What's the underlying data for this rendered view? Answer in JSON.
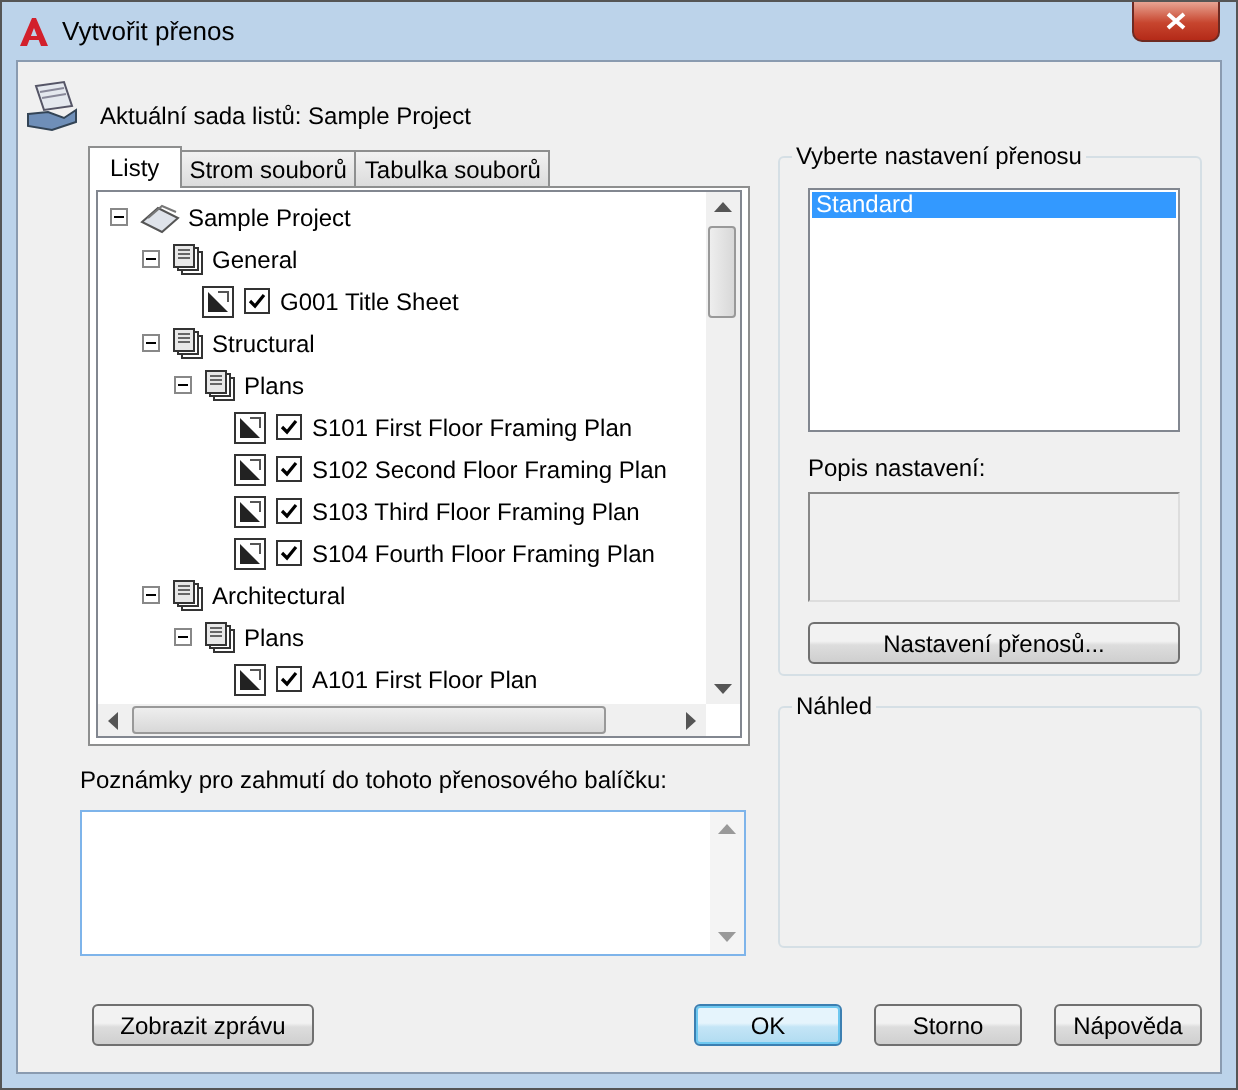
{
  "window": {
    "title": "Vytvořit přenos"
  },
  "header": {
    "label": "Aktuální sada listů: Sample Project"
  },
  "tabs": [
    {
      "label": "Listy",
      "selected": true
    },
    {
      "label": "Strom souborů",
      "selected": false
    },
    {
      "label": "Tabulka souborů",
      "selected": false
    }
  ],
  "tree": [
    {
      "label": "Sample Project",
      "kind": "project",
      "expanded": true,
      "children": [
        {
          "label": "General",
          "kind": "group",
          "expanded": true,
          "children": [
            {
              "label": "G001 Title Sheet",
              "kind": "sheet",
              "checked": true
            }
          ]
        },
        {
          "label": "Structural",
          "kind": "group",
          "expanded": true,
          "children": [
            {
              "label": "Plans",
              "kind": "group",
              "expanded": true,
              "children": [
                {
                  "label": "S101 First Floor Framing Plan",
                  "kind": "sheet",
                  "checked": true
                },
                {
                  "label": "S102 Second Floor Framing Plan",
                  "kind": "sheet",
                  "checked": true
                },
                {
                  "label": "S103 Third Floor Framing Plan",
                  "kind": "sheet",
                  "checked": true
                },
                {
                  "label": "S104 Fourth Floor Framing Plan",
                  "kind": "sheet",
                  "checked": true
                }
              ]
            }
          ]
        },
        {
          "label": "Architectural",
          "kind": "group",
          "expanded": true,
          "children": [
            {
              "label": "Plans",
              "kind": "group",
              "expanded": true,
              "children": [
                {
                  "label": "A101 First Floor Plan",
                  "kind": "sheet",
                  "checked": true
                }
              ]
            }
          ]
        }
      ]
    }
  ],
  "notes": {
    "label": "Poznámky pro zahmutí do tohoto přenosového balíčku:"
  },
  "setups": {
    "title": "Vyberte nastavení přenosu",
    "items": [
      {
        "label": "Standard",
        "selected": true
      }
    ],
    "description_label": "Popis nastavení:",
    "button": "Nastavení přenosů..."
  },
  "preview": {
    "title": "Náhled"
  },
  "buttons": [
    {
      "label": "Zobrazit zprávu",
      "default": false
    },
    {
      "label": "OK",
      "default": true
    },
    {
      "label": "Storno",
      "default": false
    },
    {
      "label": "Nápověda",
      "default": false
    }
  ]
}
